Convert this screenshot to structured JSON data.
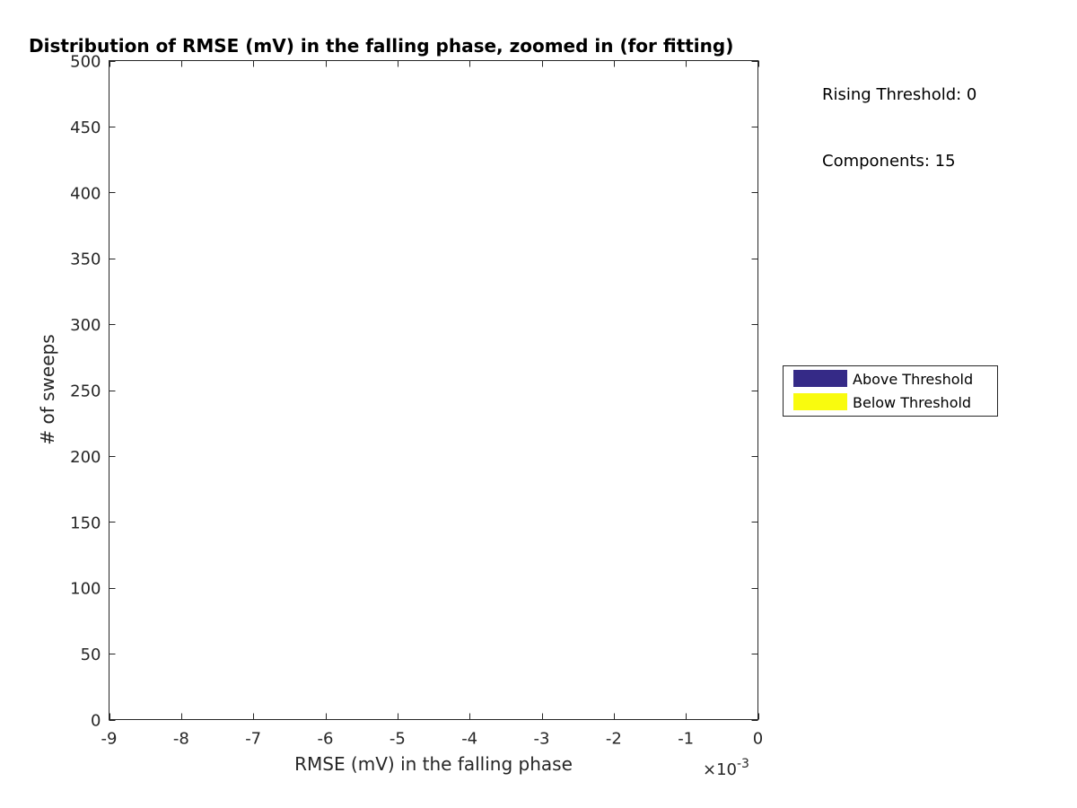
{
  "chart_data": {
    "type": "bar",
    "title": "Distribution of RMSE (mV) in the falling phase, zoomed in (for fitting)",
    "xlabel": "RMSE (mV) in the falling phase",
    "ylabel": "# of sweeps",
    "xlim": [
      -9,
      0
    ],
    "ylim": [
      0,
      500
    ],
    "x_scale_exponent_label": "×10",
    "x_scale_exponent": "-3",
    "xticks": [
      -9,
      -8,
      -7,
      -6,
      -5,
      -4,
      -3,
      -2,
      -1,
      0
    ],
    "xtick_labels": [
      "-9",
      "-8",
      "-7",
      "-6",
      "-5",
      "-4",
      "-3",
      "-2",
      "-1",
      "0"
    ],
    "yticks": [
      0,
      50,
      100,
      150,
      200,
      250,
      300,
      350,
      400,
      450,
      500
    ],
    "ytick_labels": [
      "0",
      "50",
      "100",
      "150",
      "200",
      "250",
      "300",
      "350",
      "400",
      "450",
      "500"
    ],
    "grid": false,
    "series": [
      {
        "name": "Above Threshold",
        "color": "#352a87",
        "values": []
      },
      {
        "name": "Below Threshold",
        "color": "#f9fb0e",
        "values": []
      }
    ],
    "legend": {
      "placement": "outside-right",
      "entries": [
        {
          "label": "Above Threshold",
          "color": "#352a87"
        },
        {
          "label": "Below Threshold",
          "color": "#f9fb0e"
        }
      ]
    },
    "annotations": [
      "Rising Threshold: 0",
      "Components: 15"
    ]
  }
}
